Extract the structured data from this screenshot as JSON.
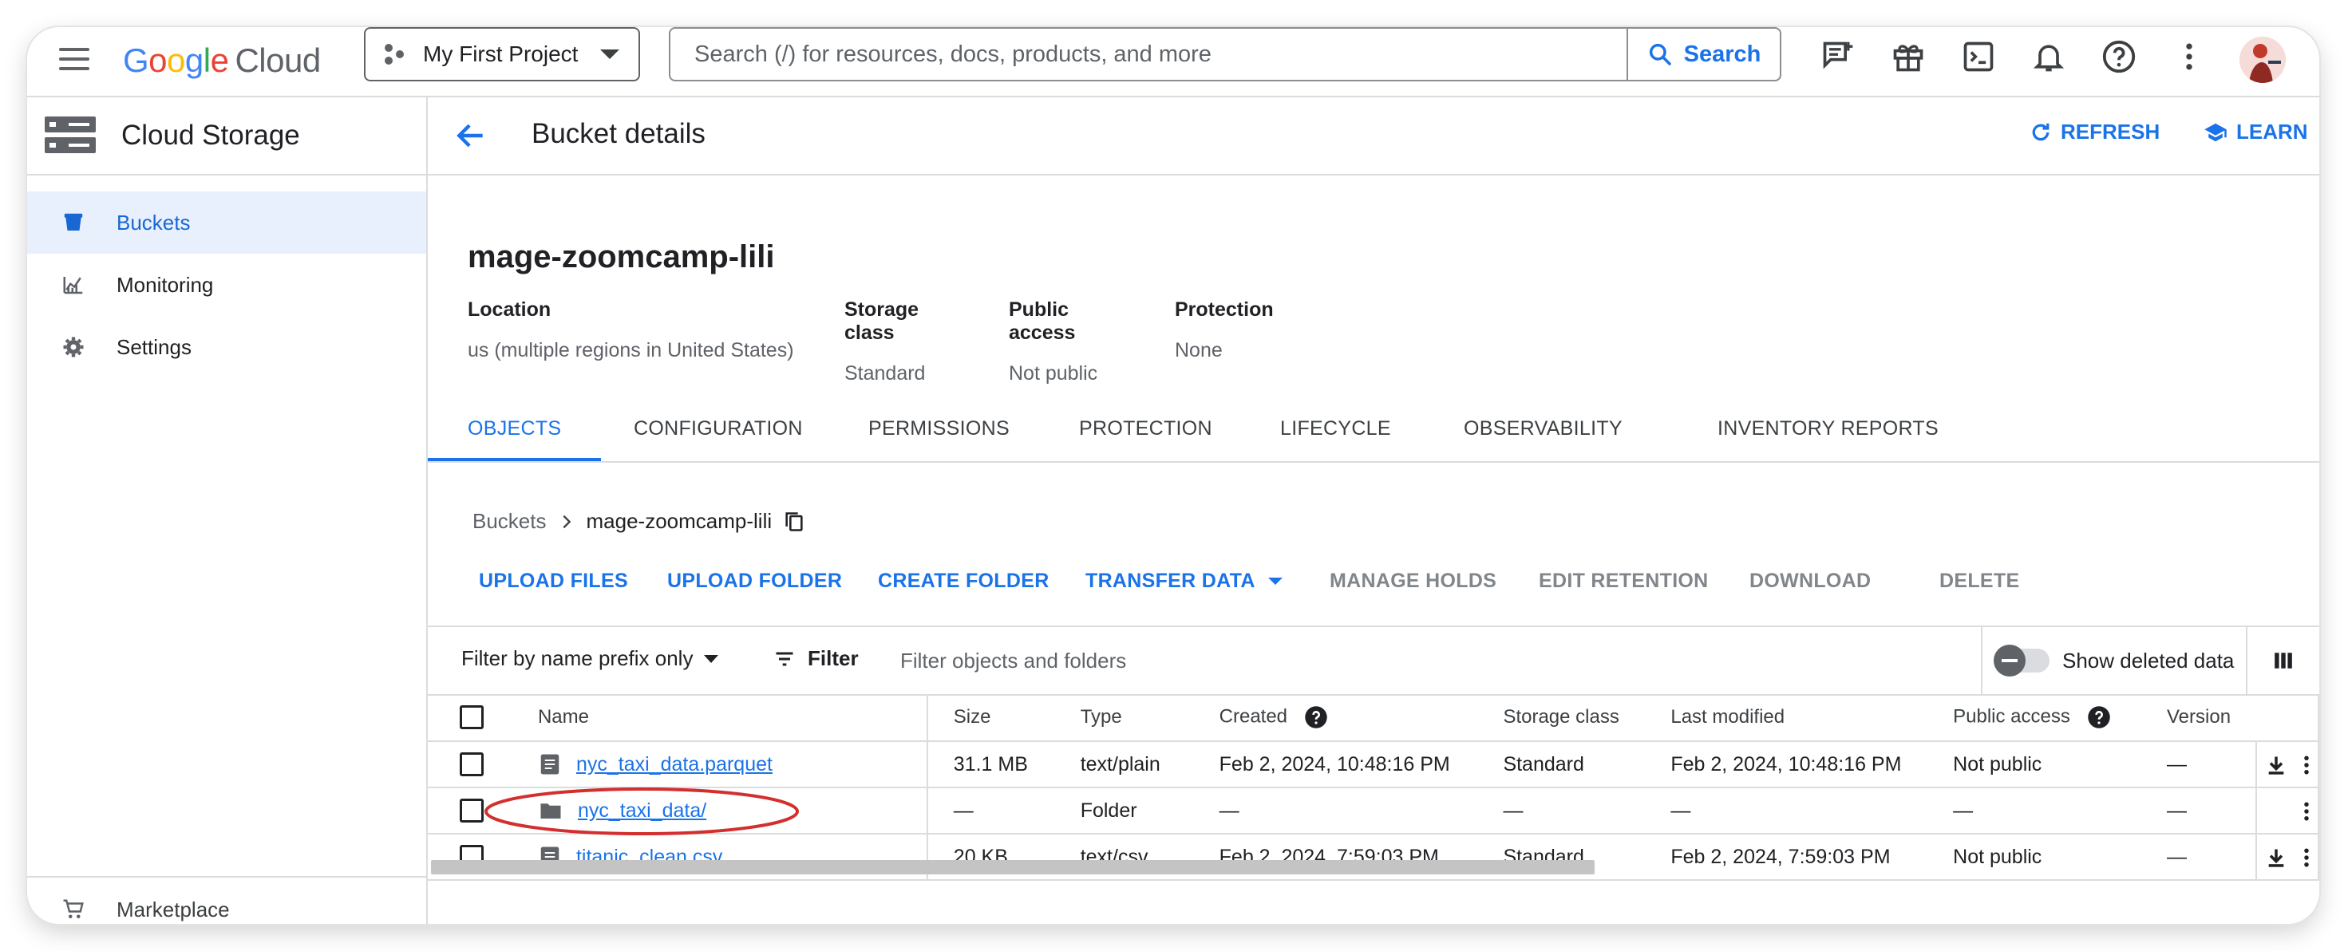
{
  "topbar": {
    "logo_google": [
      "G",
      "o",
      "o",
      "g",
      "l",
      "e"
    ],
    "logo_cloud": "Cloud",
    "project": "My First Project",
    "search_placeholder": "Search (/) for resources, docs, products, and more",
    "search_button": "Search",
    "icons": [
      "feedback-icon",
      "gift-icon",
      "terminal-icon",
      "bell-icon",
      "help-icon",
      "more-vert-icon"
    ]
  },
  "sidebar": {
    "product": "Cloud Storage",
    "items": [
      {
        "label": "Buckets",
        "icon": "bucket-icon",
        "active": true
      },
      {
        "label": "Monitoring",
        "icon": "chart-icon",
        "active": false
      },
      {
        "label": "Settings",
        "icon": "gear-icon",
        "active": false
      }
    ],
    "bottom": "Marketplace"
  },
  "header": {
    "title": "Bucket details",
    "refresh": "REFRESH",
    "learn": "LEARN"
  },
  "bucket": {
    "name": "mage-zoomcamp-lili",
    "props": [
      {
        "key": "Location",
        "value": "us (multiple regions in United States)"
      },
      {
        "key": "Storage class",
        "value": "Standard"
      },
      {
        "key": "Public access",
        "value": "Not public"
      },
      {
        "key": "Protection",
        "value": "None"
      }
    ]
  },
  "tabs": [
    "OBJECTS",
    "CONFIGURATION",
    "PERMISSIONS",
    "PROTECTION",
    "LIFECYCLE",
    "OBSERVABILITY",
    "INVENTORY REPORTS"
  ],
  "breadcrumb": {
    "root": "Buckets",
    "current": "mage-zoomcamp-lili"
  },
  "actions": {
    "upload_files": "UPLOAD FILES",
    "upload_folder": "UPLOAD FOLDER",
    "create_folder": "CREATE FOLDER",
    "transfer_data": "TRANSFER DATA",
    "manage_holds": "MANAGE HOLDS",
    "edit_retention": "EDIT RETENTION",
    "download": "DOWNLOAD",
    "delete": "DELETE"
  },
  "filter": {
    "mode": "Filter by name prefix only",
    "button": "Filter",
    "placeholder": "Filter objects and folders",
    "show_deleted": "Show deleted data"
  },
  "table": {
    "headers": [
      "Name",
      "Size",
      "Type",
      "Created",
      "Storage class",
      "Last modified",
      "Public access",
      "Version"
    ],
    "rows": [
      {
        "name": "nyc_taxi_data.parquet",
        "size": "31.1 MB",
        "type": "text/plain",
        "created": "Feb 2, 2024, 10:48:16 PM",
        "storage": "Standard",
        "modified": "Feb 2, 2024, 10:48:16 PM",
        "public": "Not public",
        "version": "—",
        "kind": "file"
      },
      {
        "name": "nyc_taxi_data/",
        "size": "—",
        "type": "Folder",
        "created": "—",
        "storage": "—",
        "modified": "—",
        "public": "—",
        "version": "—",
        "kind": "folder"
      },
      {
        "name": "titanic_clean.csv",
        "size": "20 KB",
        "type": "text/csv",
        "created": "Feb 2, 2024, 7:59:03 PM",
        "storage": "Standard",
        "modified": "Feb 2, 2024, 7:59:03 PM",
        "public": "Not public",
        "version": "—",
        "kind": "file"
      }
    ]
  },
  "colors": {
    "accent": "#1a73e8",
    "annotation": "#d32f2f"
  }
}
